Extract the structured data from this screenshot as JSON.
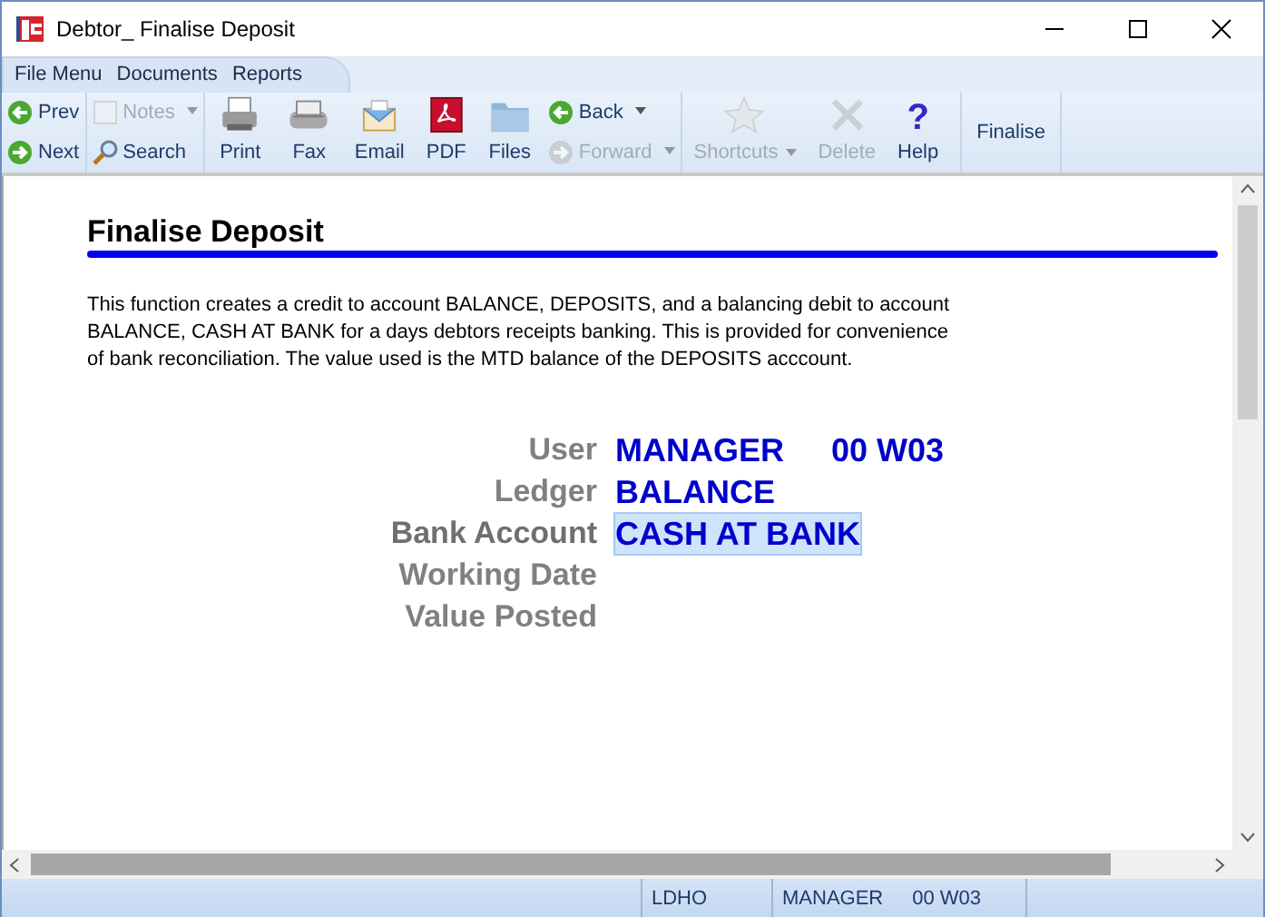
{
  "window": {
    "title": "Debtor_ Finalise Deposit"
  },
  "menu": [
    {
      "label": "File Menu"
    },
    {
      "label": "Documents"
    },
    {
      "label": "Reports"
    }
  ],
  "toolbar": [
    {
      "kind": "stack",
      "items": [
        {
          "label": "Prev",
          "disabled": false,
          "dropdown": false
        },
        {
          "label": "Next",
          "disabled": false,
          "dropdown": false
        }
      ]
    },
    {
      "kind": "stack",
      "items": [
        {
          "label": "Notes",
          "disabled": true,
          "dropdown": true
        },
        {
          "label": "Search",
          "disabled": false,
          "dropdown": false
        }
      ]
    },
    {
      "kind": "large",
      "label": "Print",
      "disabled": false,
      "dropdown": false
    },
    {
      "kind": "large",
      "label": "Fax",
      "disabled": false,
      "dropdown": false
    },
    {
      "kind": "large",
      "label": "Email",
      "disabled": false,
      "dropdown": false
    },
    {
      "kind": "large",
      "label": "PDF",
      "disabled": false,
      "dropdown": false
    },
    {
      "kind": "large",
      "label": "Files",
      "disabled": false,
      "dropdown": false
    },
    {
      "kind": "stack",
      "items": [
        {
          "label": "Back",
          "disabled": false,
          "dropdown": true
        },
        {
          "label": "Forward",
          "disabled": true,
          "dropdown": true
        }
      ]
    },
    {
      "kind": "large",
      "label": "Shortcuts",
      "disabled": true,
      "dropdown": true
    },
    {
      "kind": "large",
      "label": "Delete",
      "disabled": true,
      "dropdown": false
    },
    {
      "kind": "large",
      "label": "Help",
      "glyph": "?",
      "disabled": false,
      "dropdown": false
    },
    {
      "kind": "text",
      "label": "Finalise"
    }
  ],
  "page": {
    "heading": "Finalise Deposit",
    "description": "This function creates a credit to account BALANCE, DEPOSITS, and a balancing debit to account BALANCE, CASH AT BANK for a days debtors receipts banking. This is provided for convenience of bank reconciliation. The value used is the MTD balance of the DEPOSITS acccount.",
    "fields": [
      {
        "label": "User",
        "values": [
          "MANAGER",
          "00 W03"
        ],
        "selected": false
      },
      {
        "label": "Ledger",
        "values": [
          "BALANCE"
        ],
        "selected": false
      },
      {
        "label": "Bank Account",
        "values": [
          "CASH AT BANK"
        ],
        "selected": true
      },
      {
        "label": "Working Date",
        "selected": false
      },
      {
        "label": "Value Posted",
        "selected": false
      }
    ]
  },
  "status_bar": {
    "panels": [
      {
        "texts": [
          "LDHO"
        ]
      },
      {
        "texts": [
          "MANAGER",
          "00 W03"
        ]
      }
    ]
  }
}
